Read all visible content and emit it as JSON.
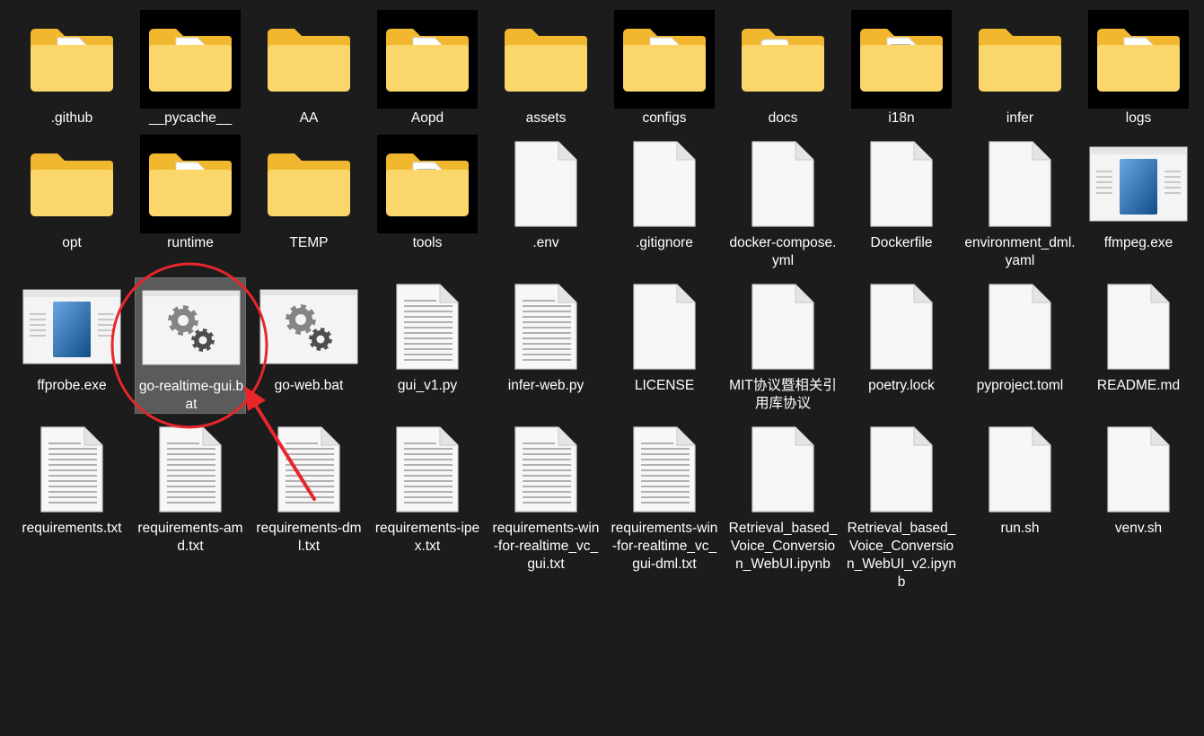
{
  "files": [
    {
      "name": ".github",
      "icon": "folder-doc-icon"
    },
    {
      "name": "__pycache__",
      "icon": "folder-doc-icon",
      "dark_bg": true
    },
    {
      "name": "AA",
      "icon": "folder-icon"
    },
    {
      "name": "Aopd",
      "icon": "folder-media-icon",
      "dark_bg": true
    },
    {
      "name": "assets",
      "icon": "folder-icon"
    },
    {
      "name": "configs",
      "icon": "folder-doc-icon",
      "dark_bg": true
    },
    {
      "name": "docs",
      "icon": "folder-app-icon"
    },
    {
      "name": "i18n",
      "icon": "folder-lines-icon",
      "dark_bg": true
    },
    {
      "name": "infer",
      "icon": "folder-icon"
    },
    {
      "name": "logs",
      "icon": "folder-doc-icon",
      "dark_bg": true
    },
    {
      "name": "opt",
      "icon": "folder-icon"
    },
    {
      "name": "runtime",
      "icon": "folder-doc-icon",
      "dark_bg": true
    },
    {
      "name": "TEMP",
      "icon": "folder-icon"
    },
    {
      "name": "tools",
      "icon": "folder-lines-icon",
      "dark_bg": true
    },
    {
      "name": ".env",
      "icon": "blank-file-icon"
    },
    {
      "name": ".gitignore",
      "icon": "blank-file-icon"
    },
    {
      "name": "docker-compose.yml",
      "icon": "blank-file-icon"
    },
    {
      "name": "Dockerfile",
      "icon": "blank-file-icon"
    },
    {
      "name": "environment_dml.yaml",
      "icon": "blank-file-icon"
    },
    {
      "name": "ffmpeg.exe",
      "icon": "exe-window-icon"
    },
    {
      "name": "ffprobe.exe",
      "icon": "exe-window-icon"
    },
    {
      "name": "go-realtime-gui.bat",
      "icon": "batch-gears-icon",
      "selected": true
    },
    {
      "name": "go-web.bat",
      "icon": "batch-gears-icon"
    },
    {
      "name": "gui_v1.py",
      "icon": "text-file-icon"
    },
    {
      "name": "infer-web.py",
      "icon": "text-file-icon"
    },
    {
      "name": "LICENSE",
      "icon": "blank-file-icon"
    },
    {
      "name": "MIT协议暨相关引用库协议",
      "icon": "blank-file-icon"
    },
    {
      "name": "poetry.lock",
      "icon": "blank-file-icon"
    },
    {
      "name": "pyproject.toml",
      "icon": "blank-file-icon"
    },
    {
      "name": "README.md",
      "icon": "blank-file-icon"
    },
    {
      "name": "requirements.txt",
      "icon": "text-file-icon"
    },
    {
      "name": "requirements-amd.txt",
      "icon": "text-file-icon"
    },
    {
      "name": "requirements-dml.txt",
      "icon": "text-file-icon"
    },
    {
      "name": "requirements-ipex.txt",
      "icon": "text-file-icon"
    },
    {
      "name": "requirements-win-for-realtime_vc_gui.txt",
      "icon": "text-file-icon"
    },
    {
      "name": "requirements-win-for-realtime_vc_gui-dml.txt",
      "icon": "text-file-icon"
    },
    {
      "name": "Retrieval_based_Voice_Conversion_WebUI.ipynb",
      "icon": "blank-file-icon"
    },
    {
      "name": "Retrieval_based_Voice_Conversion_WebUI_v2.ipynb",
      "icon": "blank-file-icon"
    },
    {
      "name": "run.sh",
      "icon": "blank-file-icon"
    },
    {
      "name": "venv.sh",
      "icon": "blank-file-icon"
    }
  ],
  "colors": {
    "background": "#1c1c1c",
    "selection": "#5b5b5b",
    "annotation": "#e8262a",
    "folder_back": "#f0b72f",
    "folder_front": "#fbd66b"
  }
}
